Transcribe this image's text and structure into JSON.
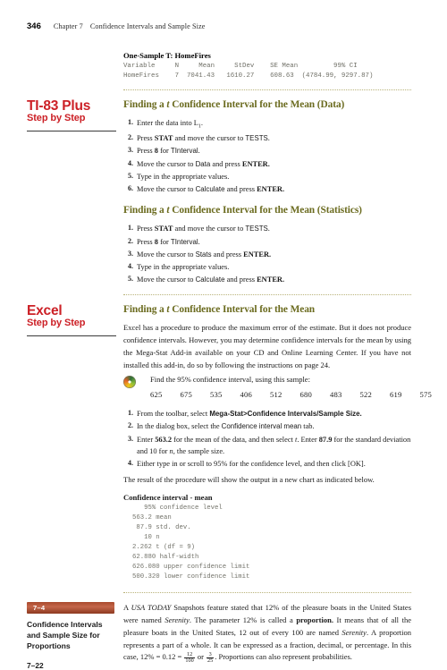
{
  "running_head": {
    "folio": "346",
    "chapter": "Chapter 7",
    "chapter_title": "Confidence Intervals and Sample Size"
  },
  "minitab_output": {
    "title": "One-Sample T: HomeFires",
    "header_row": "Variable     N     Mean     StDev    SE Mean         99% CI",
    "data_row": "HomeFires    7  7041.43   1610.27    608.63  (4784.99, 9297.87)",
    "columns": [
      "Variable",
      "N",
      "Mean",
      "StDev",
      "SE Mean",
      "99% CI"
    ],
    "values": {
      "variable": "HomeFires",
      "n": "7",
      "mean": "7041.43",
      "stdev": "1610.27",
      "se_mean": "608.63",
      "ci": "(4784.99, 9297.87)"
    }
  },
  "ti83": {
    "label_big": "TI-83 Plus",
    "label_sub": "Step by Step",
    "sections": [
      {
        "heading_pre": "Finding a ",
        "heading_ital": "t",
        "heading_post": " Confidence Interval for the Mean (Data)",
        "steps": [
          "Enter the data into L1.",
          "Press STAT and move the cursor to TESTS.",
          "Press 8 for TInterval.",
          "Move the cursor to Data and press ENTER.",
          "Type in the appropriate values.",
          "Move the cursor to Calculate and press ENTER."
        ]
      },
      {
        "heading_pre": "Finding a ",
        "heading_ital": "t",
        "heading_post": " Confidence Interval for the Mean (Statistics)",
        "steps": [
          "Press STAT and move the cursor to TESTS.",
          "Press 8 for TInterval.",
          "Move the cursor to Stats and press ENTER.",
          "Type in the appropriate values.",
          "Move the cursor to Calculate and press ENTER."
        ]
      }
    ]
  },
  "excel": {
    "label_big": "Excel",
    "label_sub": "Step by Step",
    "heading_pre": "Finding a ",
    "heading_ital": "t",
    "heading_post": " Confidence Interval for the Mean",
    "intro": "Excel has a procedure to produce the maximum error of the estimate. But it does not produce confidence intervals. However, you may determine confidence intervals for the mean by using the Mega-Stat Add-in available on your CD and Online Learning Center. If you have not installed this add-in, do so by following the instructions on page 24.",
    "find_line": "Find the 95% confidence interval, using this sample:",
    "sample": [
      "625",
      "675",
      "535",
      "406",
      "512",
      "680",
      "483",
      "522",
      "619",
      "575"
    ],
    "steps": [
      "From the toolbar, select Mega-Stat>Confidence Intervals/Sample Size.",
      "In the dialog box, select the Confidence interval mean tab.",
      "Enter 563.2 for the mean of the data, and then select t. Enter 87.9 for the standard deviation and 10 for n, the sample size.",
      "Either type in or scroll to 95% for the confidence level, and then click [OK]."
    ],
    "result_note": "The result of the procedure will show the output in a new chart as indicated below.",
    "output_title": "Confidence interval - mean",
    "output_lines": [
      "   95% confidence level",
      "563.2 mean",
      " 87.9 std. dev.",
      "   10 n",
      "2.262 t (df = 9)",
      "62.880 half-width",
      "626.080 upper confidence limit",
      "500.320 lower confidence limit"
    ]
  },
  "section_marginal": {
    "badge": "7–4",
    "name": "Confidence Intervals and Sample Size for Proportions",
    "folio": "7–22"
  },
  "closing_paragraph": {
    "part1": "A ",
    "usa_today": "USA TODAY",
    "part2": " Snapshots feature stated that 12% of the pleasure boats in the United States were named ",
    "serenity1": "Serenity",
    "part3": ". The parameter 12% is called a ",
    "proportion": "proportion.",
    "part4": " It means that of all the pleasure boats in the United States, 12 out of every 100 are named ",
    "serenity2": "Serenity",
    "part5": ". A proportion represents a part of a whole. It can be expressed as a fraction, decimal, or percentage. In this case, 12% = 0.12 = ",
    "frac1_num": "12",
    "frac1_den": "100",
    "or": " or ",
    "frac2_num": "3",
    "frac2_den": "25",
    "part6": ". Proportions can also represent probabilities."
  },
  "colors": {
    "red": "#cc2026",
    "olive_heading": "#6b6b1f",
    "dotted_rule": "#b9b37a",
    "badge_brown": "#a8492c",
    "mono_gray": "#6f6f66"
  }
}
